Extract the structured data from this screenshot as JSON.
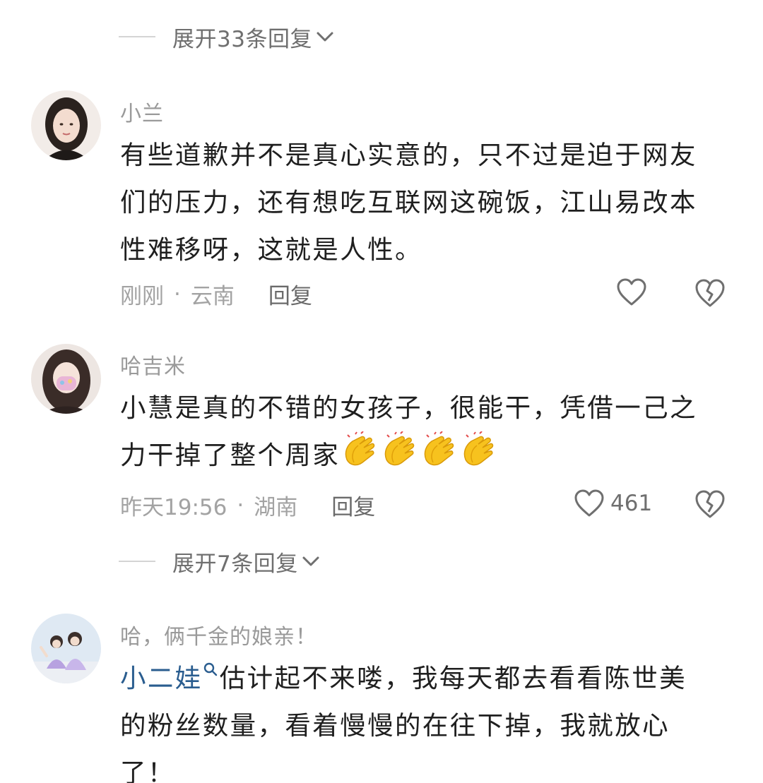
{
  "expand_top": {
    "label": "展开33条回复"
  },
  "comments": [
    {
      "username": "小兰",
      "lines": [
        "有些道歉并不是真心实意的，只不过是迫于网友",
        "们的压力，还有想吃互联网这碗饭，江山易改本",
        "性难移呀，这就是人性。"
      ],
      "time": "刚刚",
      "location": "云南",
      "reply_label": "回复",
      "like_count": ""
    },
    {
      "username": "哈吉米",
      "lines": [
        "小慧是真的不错的女孩子，很能干，凭借一己之",
        "力干掉了整个周家"
      ],
      "emoji": [
        "clapping-hands",
        "clapping-hands",
        "clapping-hands",
        "clapping-hands"
      ],
      "time": "昨天19:56",
      "location": "湖南",
      "reply_label": "回复",
      "like_count": "461"
    },
    {
      "username": "哈，俩千金的娘亲！",
      "mention": "小二娃",
      "lines": [
        "估计起不来喽，我每天都去看看陈世美",
        "的粉丝数量，看着慢慢的在往下掉，我就放心",
        "了！"
      ]
    }
  ],
  "expand_mid": {
    "label": "展开7条回复"
  },
  "separator": "·",
  "icons": {
    "like": "heart-outline-icon",
    "dislike": "broken-heart-icon",
    "expand": "chevron-down-icon",
    "mention": "search-icon"
  },
  "colors": {
    "text": "#1f1f1f",
    "meta": "#a3a3a3",
    "mention": "#2a5d8f"
  }
}
